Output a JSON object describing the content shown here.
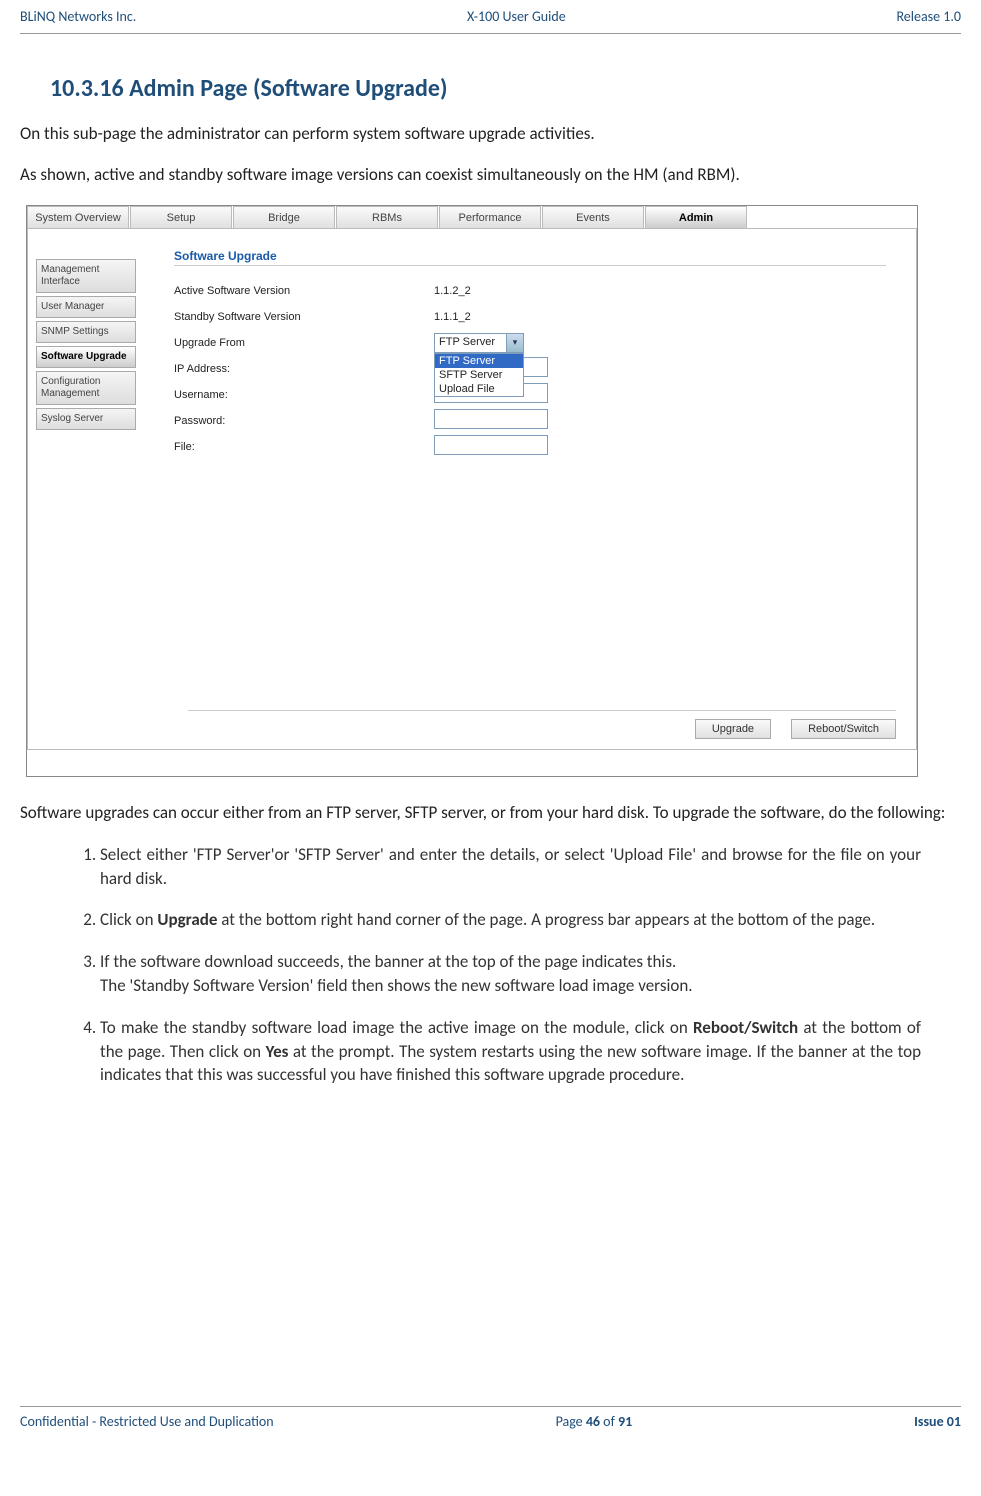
{
  "header": {
    "company": "BLiNQ Networks Inc.",
    "doc": "X-100 User Guide",
    "release": "Release 1.0"
  },
  "section_heading": "10.3.16 Admin Page (Software Upgrade)",
  "para1": "On this sub-page the administrator can perform system software upgrade activities.",
  "para2": "As shown, active and standby software image versions can coexist simultaneously on the HM (and RBM).",
  "screenshot": {
    "tabs": [
      "System Overview",
      "Setup",
      "Bridge",
      "RBMs",
      "Performance",
      "Events",
      "Admin"
    ],
    "active_tab_index": 6,
    "sidebar": [
      "Management Interface",
      "User Manager",
      "SNMP Settings",
      "Software Upgrade",
      "Configuration Management",
      "Syslog Server"
    ],
    "active_side_index": 3,
    "panel_title": "Software Upgrade",
    "rows": {
      "active_label": "Active Software Version",
      "active_value": "1.1.2_2",
      "standby_label": "Standby Software Version",
      "standby_value": "1.1.1_2",
      "upgrade_from_label": "Upgrade From",
      "ip_label": "IP Address:",
      "user_label": "Username:",
      "pass_label": "Password:",
      "file_label": "File:"
    },
    "combo": {
      "selected": "FTP Server",
      "options": [
        "FTP Server",
        "SFTP Server",
        "Upload File"
      ]
    },
    "buttons": {
      "upgrade": "Upgrade",
      "reboot": "Reboot/Switch"
    }
  },
  "para3": "Software upgrades can occur either from an FTP server, SFTP server, or from your hard disk. To upgrade the software, do the following:",
  "steps": {
    "s1": "Select either 'FTP Server'or 'SFTP Server' and enter the details, or select 'Upload File' and browse for the file on your hard disk.",
    "s2a": "Click on ",
    "s2b": "Upgrade",
    "s2c": " at the bottom right hand corner of the page. A progress bar appears at the bottom of the page.",
    "s3a": "If the software download succeeds, the banner at the top of the page indicates this.",
    "s3b": "The 'Standby Software Version' field then shows the new software load image version.",
    "s4a": "To make the standby software load image the active image on the module, click on ",
    "s4b": "Reboot/Switch",
    "s4c": " at the bottom of the page. Then click on ",
    "s4d": "Yes",
    "s4e": " at the prompt. The system restarts using the new software image. If the banner at the top indicates that this was successful you have finished this software upgrade procedure."
  },
  "footer": {
    "left": "Confidential - Restricted Use and Duplication",
    "mid_a": "Page ",
    "mid_b": "46",
    "mid_c": " of ",
    "mid_d": "91",
    "right": "Issue 01"
  }
}
